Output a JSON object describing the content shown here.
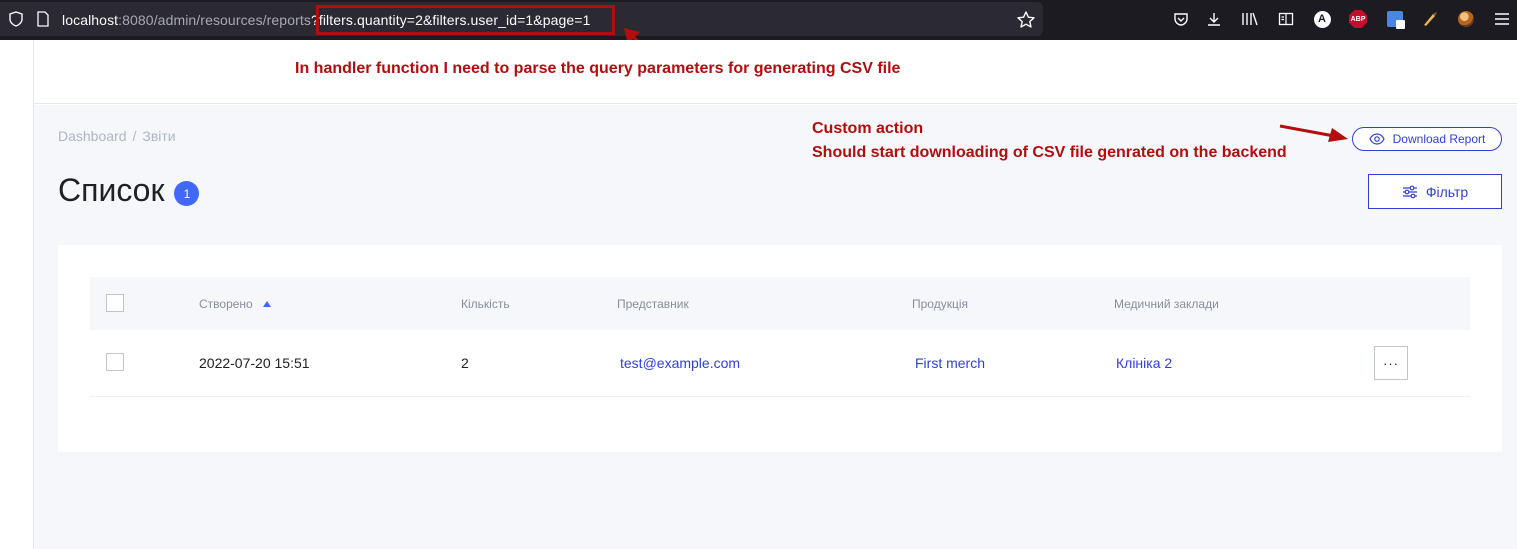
{
  "browser": {
    "url_host": "localhost",
    "url_rest": ":8080/admin/resources/reports",
    "url_query": "?filters.quantity=2&filters.user_id=1&page=1",
    "toolbar_icons": [
      "pocket-icon",
      "download-icon",
      "library-icon",
      "reader-icon",
      "account-icon",
      "adblock-icon",
      "translate-icon",
      "extension-icon",
      "profile-icon",
      "menu-icon"
    ],
    "abp_label": "ABP",
    "account_letter": "A"
  },
  "annotations": {
    "query_note": "In handler function I need to parse the query parameters for generating CSV file",
    "custom_action_title": "Custom action",
    "custom_action_desc": "Should start downloading of CSV file genrated on the backend",
    "color": "#b40d0d"
  },
  "breadcrumb": {
    "items": [
      "Dashboard",
      "/",
      "Звіти"
    ]
  },
  "actions": {
    "download_label": "Download Report",
    "filter_label": "Фільтр"
  },
  "page": {
    "title": "Список",
    "count": "1"
  },
  "table": {
    "columns": [
      "Створено",
      "Кількість",
      "Представник",
      "Продукція",
      "Медичний заклади"
    ],
    "rows": [
      {
        "created": "2022-07-20 15:51",
        "quantity": "2",
        "representative": "test@example.com",
        "product": "First merch",
        "clinic": "Клініка 2",
        "more": "···"
      }
    ]
  },
  "colors": {
    "accent": "#3040d6",
    "badge": "#4268f6",
    "background": "#f6f7fb"
  }
}
